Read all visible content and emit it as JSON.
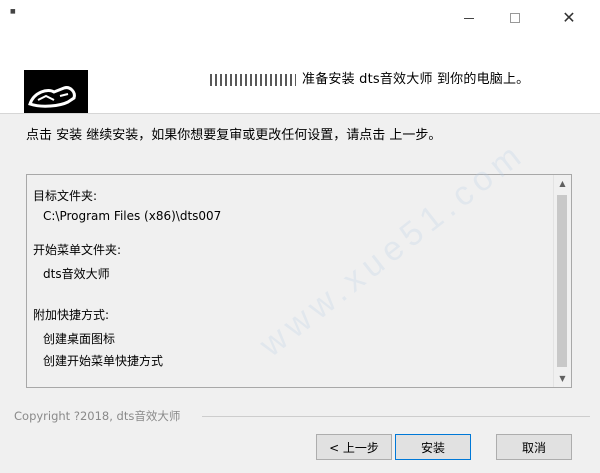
{
  "window": {
    "title": "■",
    "minimize_icon": "minimize-icon",
    "maximize_icon": "maximize-icon",
    "close_glyph": "✕"
  },
  "header": {
    "text": "准备安装 dts音效大师 到你的电脑上。"
  },
  "instruction": "点击 安装 继续安装，如果你想要复审或更改任何设置，请点击 上一步。",
  "summary": {
    "dest_label": "目标文件夹:",
    "dest_value": "C:\\Program Files (x86)\\dts007",
    "startmenu_label": "开始菜单文件夹:",
    "startmenu_value": "dts音效大师",
    "shortcuts_label": "附加快捷方式:",
    "shortcut_1": "创建桌面图标",
    "shortcut_2": "创建开始菜单快捷方式"
  },
  "scrollbar": {
    "up_glyph": "▲",
    "down_glyph": "▼"
  },
  "footer": {
    "copyright": "Copyright ?2018, dts音效大师",
    "back_label": "< 上一步",
    "install_label": "安装",
    "cancel_label": "取消"
  },
  "watermark": "www.xue51.com",
  "colors": {
    "accent": "#0078d7",
    "background": "#f0f0f0"
  }
}
